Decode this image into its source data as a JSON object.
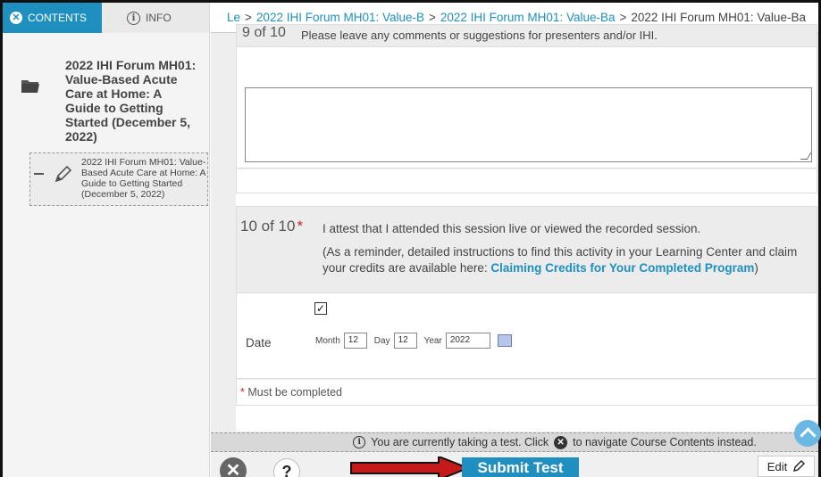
{
  "sidebar": {
    "tabs": [
      {
        "label": "CONTENTS",
        "icon": "close-circle-icon"
      },
      {
        "label": "INFO",
        "icon": "info-circle-icon"
      }
    ],
    "course": {
      "title": "2022 IHI Forum MH01: Value-Based Acute Care at Home: A Guide to Getting Started (December 5, 2022)",
      "icon": "folder-icon"
    },
    "module": {
      "title": "2022 IHI Forum MH01: Value-Based Acute Care at Home: A Guide to Getting Started (December 5, 2022)",
      "icon": "pencil-icon"
    }
  },
  "breadcrumb": {
    "items": [
      {
        "label": "Le",
        "type": "link"
      },
      {
        "label": "2022 IHI Forum MH01: Value-B",
        "type": "link"
      },
      {
        "label": "2022 IHI Forum MH01: Value-Ba",
        "type": "link"
      },
      {
        "label": "2022 IHI Forum MH01: Value-Ba",
        "type": "current"
      }
    ],
    "separator": ">"
  },
  "question9": {
    "number": "9 of 10",
    "text": "Please leave any comments or suggestions for presenters and/or IHI.",
    "answer": ""
  },
  "question10": {
    "number": "10 of 10",
    "required_marker": "*",
    "text": "I attest that I attended this session live or viewed the recorded session.",
    "reminder_prefix": "(As a reminder, detailed instructions to find this activity in your Learning Center and claim your credits are available here: ",
    "reminder_link": "Claiming Credits for Your Completed Program",
    "reminder_suffix": ")",
    "checkbox_mark": "✓",
    "checked": true
  },
  "date": {
    "label": "Date",
    "month_label": "Month",
    "month": "12",
    "day_label": "Day",
    "day": "12",
    "year_label": "Year",
    "year": "2022"
  },
  "required_note": {
    "marker": "*",
    "text": "Must be completed"
  },
  "status": {
    "text_before": "You are currently taking a test. Click",
    "text_after": "to navigate Course Contents instead."
  },
  "toolbar": {
    "help_label": "?",
    "submit_label": "Submit Test",
    "edit_label": "Edit"
  },
  "colors": {
    "accent": "#1f8fc0",
    "required": "#c62828",
    "arrow": "#c41a1a"
  }
}
